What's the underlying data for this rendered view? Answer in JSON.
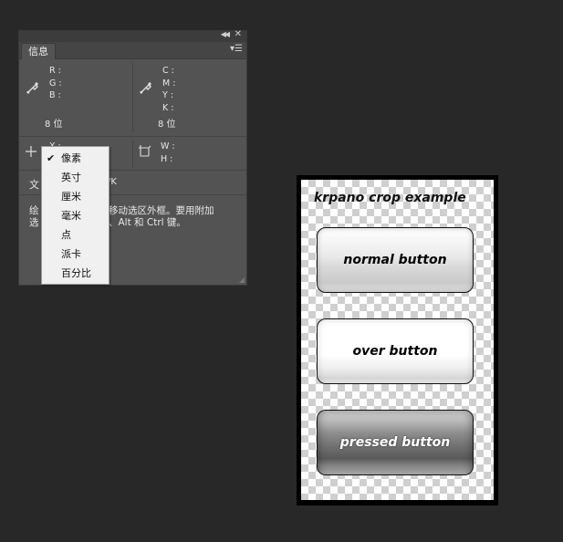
{
  "info_panel": {
    "tab_label": "信息",
    "rgb_labels": [
      "R :",
      "G :",
      "B :"
    ],
    "cmyk_labels": [
      "C :",
      "M :",
      "Y :",
      "K :"
    ],
    "bits_left": "8 位",
    "bits_right": "8 位",
    "xy_labels": [
      "X :",
      "Y :"
    ],
    "wh_labels": [
      "W :",
      "H :"
    ],
    "doc_prefix": "文",
    "doc_suffix": "/K",
    "hint_line1_start": "绘",
    "hint_line1_end": "移动选区外框。要用附加",
    "hint_line2_start": "选",
    "hint_line2_end": "、Alt 和 Ctrl 键。"
  },
  "unit_menu": {
    "selected": "像素",
    "items": [
      "像素",
      "英寸",
      "厘米",
      "毫米",
      "点",
      "派卡",
      "百分比"
    ]
  },
  "krpano_example": {
    "title": "krpano crop example",
    "buttons": {
      "normal": "normal button",
      "over": "over button",
      "pressed": "pressed button"
    }
  },
  "colors": {
    "workspace_bg": "#282828",
    "panel_bg": "#535353",
    "menu_bg": "#f0f0f0"
  },
  "icons": [
    "collapse-icon",
    "close-icon",
    "panel-menu-icon",
    "eyedropper-icon",
    "crosshair-icon",
    "selection-size-icon",
    "check-icon",
    "resize-grip-icon"
  ]
}
